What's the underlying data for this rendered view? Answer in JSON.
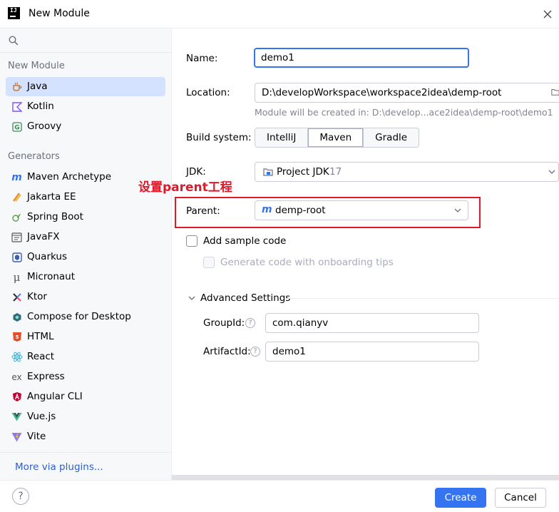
{
  "window": {
    "title": "New Module",
    "logo_text": "IJ"
  },
  "sidebar": {
    "search_placeholder": "",
    "new_module_header": "New Module",
    "new_module_items": [
      {
        "label": "Java",
        "icon": "java-icon"
      },
      {
        "label": "Kotlin",
        "icon": "kotlin-icon"
      },
      {
        "label": "Groovy",
        "icon": "groovy-icon"
      }
    ],
    "generators_header": "Generators",
    "generator_items": [
      {
        "label": "Maven Archetype",
        "icon": "maven-icon"
      },
      {
        "label": "Jakarta EE",
        "icon": "jakarta-icon"
      },
      {
        "label": "Spring Boot",
        "icon": "spring-icon"
      },
      {
        "label": "JavaFX",
        "icon": "javafx-icon"
      },
      {
        "label": "Quarkus",
        "icon": "quarkus-icon"
      },
      {
        "label": "Micronaut",
        "icon": "micronaut-icon"
      },
      {
        "label": "Ktor",
        "icon": "ktor-icon"
      },
      {
        "label": "Compose for Desktop",
        "icon": "compose-icon"
      },
      {
        "label": "HTML",
        "icon": "html-icon"
      },
      {
        "label": "React",
        "icon": "react-icon"
      },
      {
        "label": "Express",
        "icon": "express-icon"
      },
      {
        "label": "Angular CLI",
        "icon": "angular-icon"
      },
      {
        "label": "Vue.js",
        "icon": "vue-icon"
      },
      {
        "label": "Vite",
        "icon": "vite-icon"
      }
    ],
    "more_plugins": "More via plugins..."
  },
  "form": {
    "name_label": "Name:",
    "name_value": "demo1",
    "location_label": "Location:",
    "location_value": "D:\\developWorkspace\\workspace2idea\\demp-root",
    "location_hint": "Module will be created in: D:\\develop...ace2idea\\demp-root\\demo1",
    "build_label": "Build system:",
    "build_options": [
      "IntelliJ",
      "Maven",
      "Gradle"
    ],
    "build_selected": "Maven",
    "jdk_label": "JDK:",
    "jdk_value": "Project JDK",
    "jdk_version": "17",
    "parent_label": "Parent:",
    "parent_value": "demp-root",
    "sample_code_label": "Add sample code",
    "onboarding_label": "Generate code with onboarding tips",
    "advanced_label": "Advanced Settings",
    "groupid_label": "GroupId:",
    "groupid_value": "com.qianyv",
    "artifactid_label": "ArtifactId:",
    "artifactid_value": "demo1"
  },
  "annotation": {
    "text": "设置parent工程",
    "color": "#e0192a"
  },
  "footer": {
    "help": "?",
    "create_label": "Create",
    "cancel_label": "Cancel"
  },
  "colors": {
    "accent": "#3574f0",
    "selection": "#d4e2ff",
    "link": "#2f5dc8"
  }
}
